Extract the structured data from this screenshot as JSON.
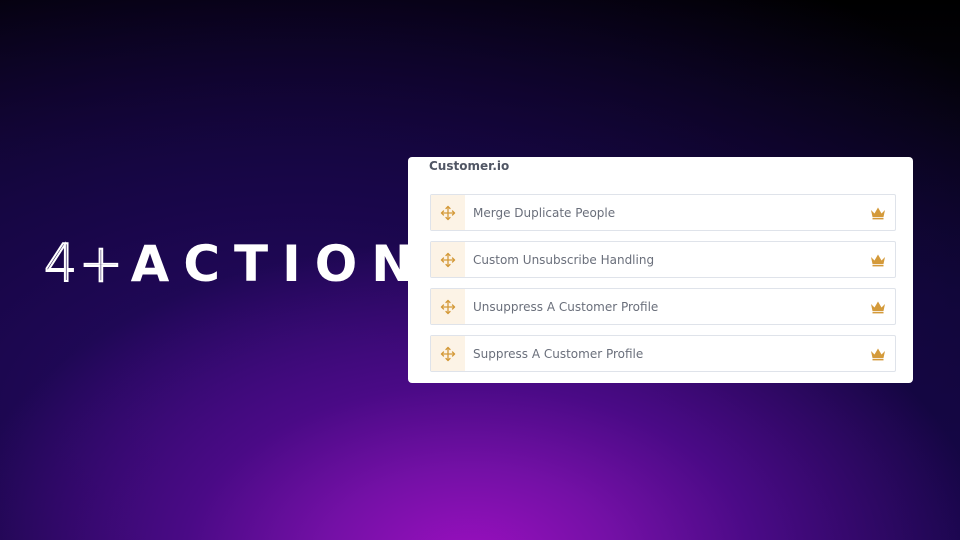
{
  "headline": {
    "number": "4+",
    "word": "ACTIONS"
  },
  "card": {
    "title": "Customer.io",
    "items": [
      {
        "label": "Merge Duplicate People",
        "handle_icon": "move-icon",
        "badge_icon": "crown-icon"
      },
      {
        "label": "Custom Unsubscribe Handling",
        "handle_icon": "move-icon",
        "badge_icon": "crown-icon"
      },
      {
        "label": "Unsuppress A Customer Profile",
        "handle_icon": "move-icon",
        "badge_icon": "crown-icon"
      },
      {
        "label": "Suppress A Customer Profile",
        "handle_icon": "move-icon",
        "badge_icon": "crown-icon"
      }
    ]
  },
  "colors": {
    "accent": "#d49a3a",
    "handle_bg": "#fcf3e6",
    "label": "#6a6f7b",
    "title": "#505664"
  }
}
